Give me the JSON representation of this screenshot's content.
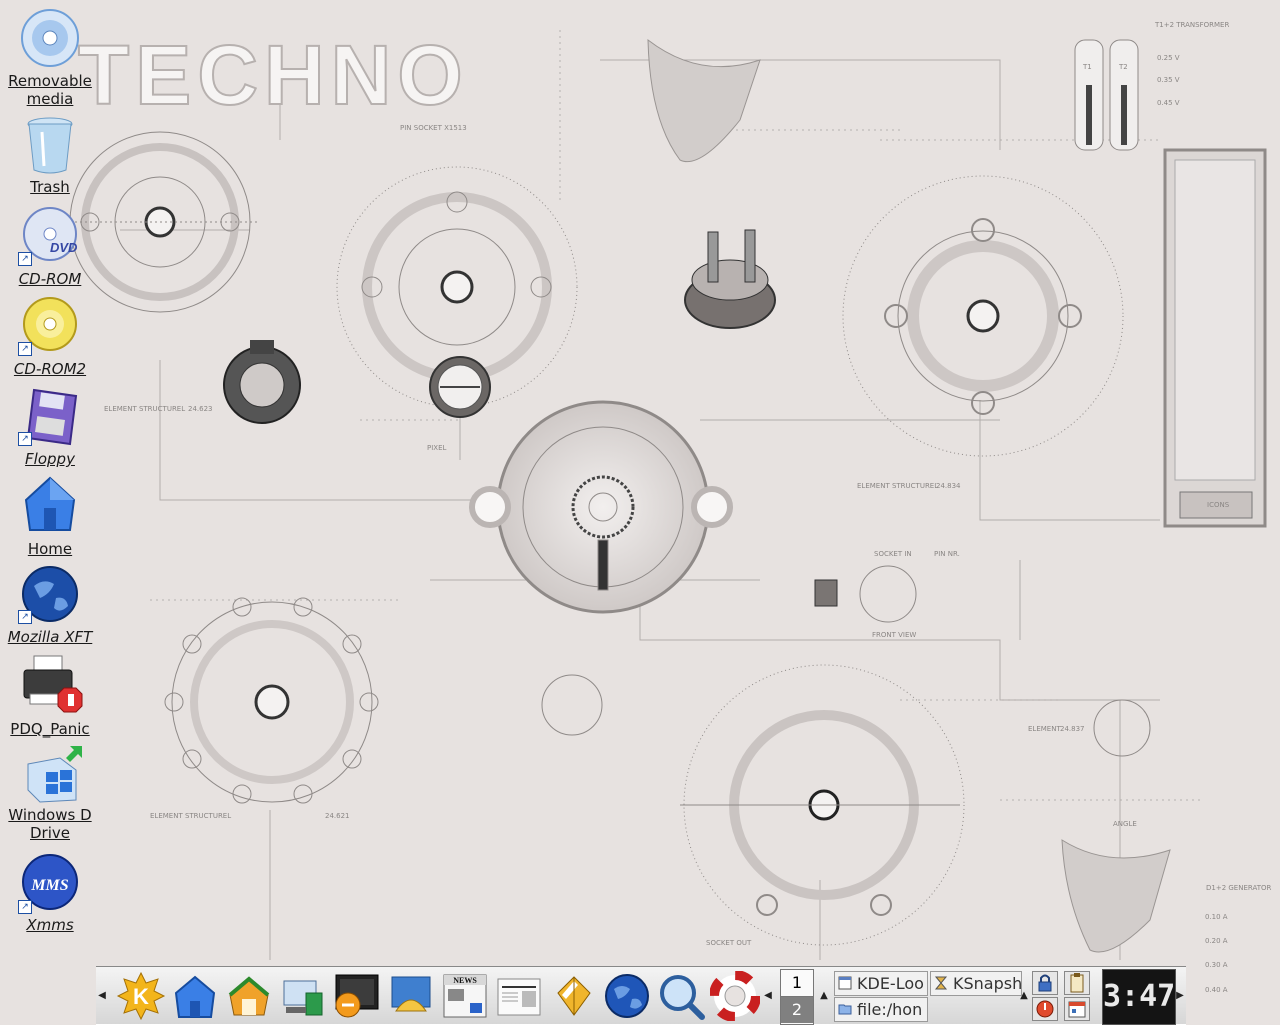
{
  "wallpaper": {
    "logo_text": "TECHNO",
    "labels": {
      "pin_socket": "PIN SOCKET X1513",
      "element_1": "ELEMENT STRUCTUREL",
      "element_1_val": "24.623",
      "element_2": "ELEMENT STRUCTUREL",
      "element_2_val": "24.834",
      "element_3": "ELEMENT STRUCTUREL",
      "element_3_val": "24.621",
      "element_4": "ELEMENT",
      "element_4_val": "24.837",
      "transformer": "T1+2 TRANSFORMER",
      "generator": "D1+2 GENERATOR",
      "socket_in": "SOCKET IN",
      "pin_nr": "PIN NR.",
      "front_view": "FRONT VIEW",
      "socket_out": "SOCKET OUT",
      "icons_panel": "ICONS",
      "angle": "ANGLE",
      "pixel": "PIXEL",
      "t1": "T1",
      "t2": "T2",
      "volts": [
        "0.25 V",
        "0.35 V",
        "0.45 V"
      ],
      "amps": [
        "0.10 A",
        "0.20 A",
        "0.30 A",
        "0.40 A"
      ]
    }
  },
  "desktop_icons": [
    {
      "name": "removable-media",
      "label": "Removable media",
      "icon": "cd-disc-icon",
      "shortcut": false
    },
    {
      "name": "trash",
      "label": "Trash",
      "icon": "trash-bin-icon",
      "shortcut": false
    },
    {
      "name": "cd-rom",
      "label": "CD-ROM",
      "icon": "dvd-disc-icon",
      "shortcut": true
    },
    {
      "name": "cd-rom2",
      "label": "CD-ROM2",
      "icon": "gold-cd-icon",
      "shortcut": true
    },
    {
      "name": "floppy",
      "label": "Floppy",
      "icon": "floppy-disk-icon",
      "shortcut": true
    },
    {
      "name": "home",
      "label": "Home",
      "icon": "home-folder-icon",
      "shortcut": false
    },
    {
      "name": "mozilla-xft",
      "label": "Mozilla XFT",
      "icon": "globe-icon",
      "shortcut": true
    },
    {
      "name": "pdq-panic",
      "label": "PDQ_Panic",
      "icon": "printer-stop-icon",
      "shortcut": false
    },
    {
      "name": "windows-d-drive",
      "label": "Windows D Drive",
      "icon": "windows-drive-icon",
      "shortcut": false
    },
    {
      "name": "xmms",
      "label": "Xmms",
      "icon": "xmms-icon",
      "shortcut": true
    }
  ],
  "taskbar": {
    "launchers": [
      {
        "name": "kmenu",
        "icon": "k-menu-icon"
      },
      {
        "name": "home-folder",
        "icon": "home-folder-icon"
      },
      {
        "name": "konqueror-home",
        "icon": "house-icon"
      },
      {
        "name": "kcontrol",
        "icon": "control-center-icon"
      },
      {
        "name": "terminal",
        "icon": "terminal-icon"
      },
      {
        "name": "kpaint",
        "icon": "image-viewer-icon"
      },
      {
        "name": "knewsticker",
        "icon": "news-icon"
      },
      {
        "name": "newspaper",
        "icon": "newspaper-icon"
      },
      {
        "name": "kate",
        "icon": "text-editor-icon"
      },
      {
        "name": "browser",
        "icon": "globe-icon"
      },
      {
        "name": "kfind",
        "icon": "magnifier-icon"
      },
      {
        "name": "help",
        "icon": "lifebuoy-icon"
      }
    ],
    "pager": {
      "desktop_1": "1",
      "desktop_2": "2"
    },
    "tasks": [
      {
        "name": "task-kde-look",
        "label": "KDE-Loo"
      },
      {
        "name": "task-ksnapshot",
        "label": "KSnapsh"
      },
      {
        "name": "task-file-home",
        "label": "file:/hon"
      }
    ],
    "clock": "3:47"
  },
  "colors": {
    "background": "#e7e2e0",
    "line": "#8a8684",
    "taskbar": "#dcdcdc",
    "clock_bg": "#141414"
  }
}
